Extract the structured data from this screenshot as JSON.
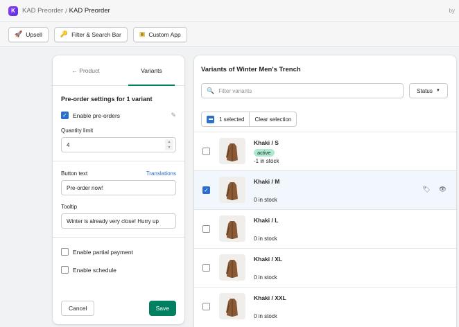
{
  "header": {
    "app_name": "KAD Preorder",
    "separator": "/",
    "page_name": "KAD Preorder",
    "by_label": "by",
    "logo_letter": "K"
  },
  "toolbar": {
    "buttons": [
      {
        "label": "Upsell",
        "icon": "rocket-icon",
        "glyph": "🚀"
      },
      {
        "label": "Filter & Search Bar",
        "icon": "key-icon",
        "glyph": "🔑"
      },
      {
        "label": "Custom App",
        "icon": "film-icon",
        "glyph": "▣"
      }
    ]
  },
  "left_panel": {
    "tabs": [
      {
        "label": "← Product",
        "active": false
      },
      {
        "label": "Variants",
        "active": true
      }
    ],
    "title": "Pre-order settings for 1 variant",
    "enable_preorders": {
      "label": "Enable pre-orders",
      "checked": true
    },
    "quantity_limit": {
      "label": "Quantity limit",
      "value": "4"
    },
    "button_text": {
      "label": "Button text",
      "link": "Translations",
      "value": "Pre-order now!"
    },
    "tooltip": {
      "label": "Tooltip",
      "value": "Winter is already very close! Hurry up"
    },
    "partial_payment": {
      "label": "Enable partial payment",
      "checked": false
    },
    "schedule": {
      "label": "Enable schedule",
      "checked": false
    },
    "cancel_label": "Cancel",
    "save_label": "Save"
  },
  "right_panel": {
    "title": "Variants of Winter Men's Trench",
    "search_placeholder": "Filter variants",
    "status_label": "Status",
    "selected_count": "1 selected",
    "clear_label": "Clear selection",
    "variants": [
      {
        "name": "Khaki / S",
        "badge": "active",
        "stock": "-1 in stock",
        "selected": false
      },
      {
        "name": "Khaki / M",
        "badge": "",
        "stock": "0 in stock",
        "selected": true
      },
      {
        "name": "Khaki / L",
        "badge": "",
        "stock": "0 in stock",
        "selected": false
      },
      {
        "name": "Khaki / XL",
        "badge": "",
        "stock": "0 in stock",
        "selected": false
      },
      {
        "name": "Khaki / XXL",
        "badge": "",
        "stock": "0 in stock",
        "selected": false
      }
    ]
  },
  "colors": {
    "primary_green": "#008060",
    "selection_blue": "#2c6ecb",
    "active_badge": "#aee9d1",
    "selected_row_bg": "#f2f7fe"
  }
}
